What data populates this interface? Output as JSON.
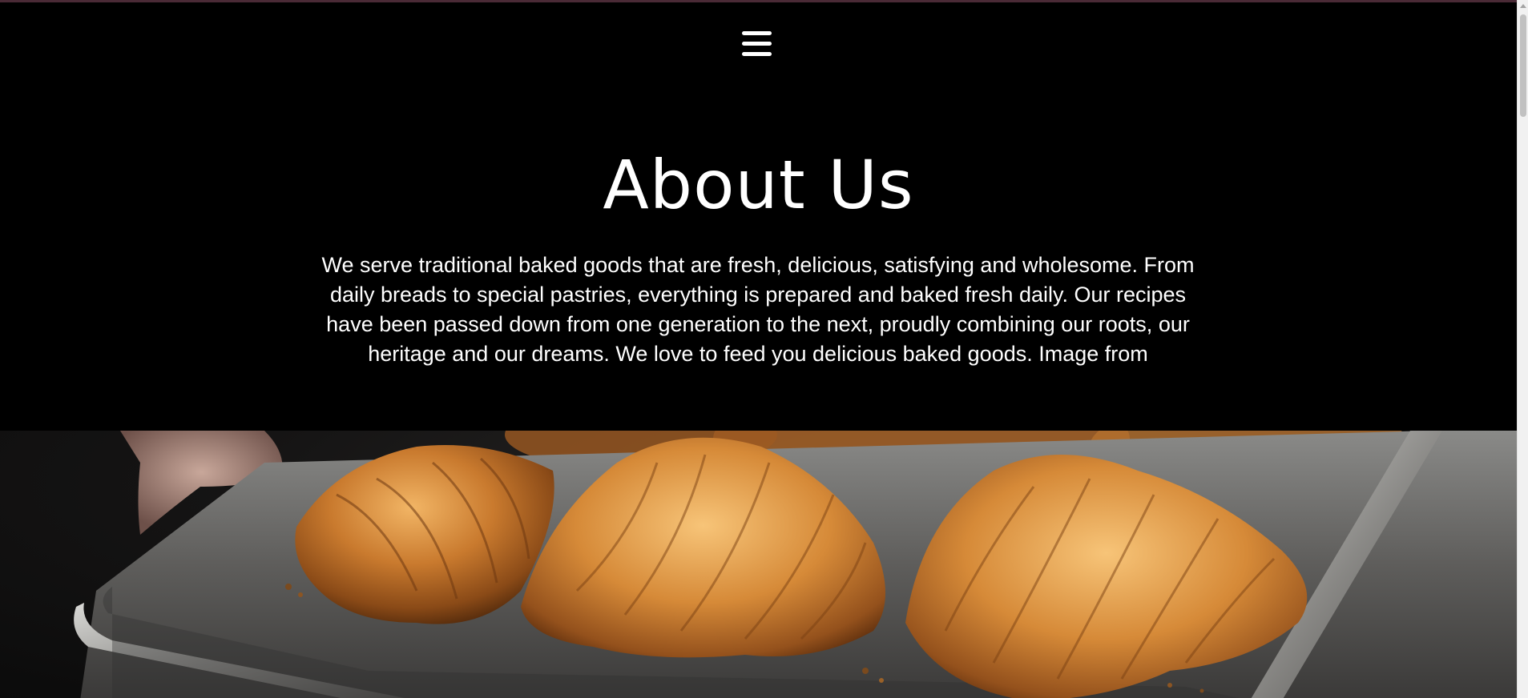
{
  "nav": {
    "menu_icon": "hamburger-menu-icon"
  },
  "about": {
    "title": "About Us",
    "body": "We serve traditional baked goods that are fresh, delicious, satisfying and wholesome. From daily breads to special pastries, everything is prepared and baked fresh daily. Our recipes have been passed down from one generation to the next, proudly combining our roots, our heritage and our dreams. We love to feed you delicious baked goods. Image from"
  },
  "hero": {
    "image_subject": "croissants-on-baking-tray"
  },
  "colors": {
    "background": "#000000",
    "text": "#ffffff",
    "top_rule": "#4a2a36",
    "scrollbar_track": "#f1f1f1",
    "scrollbar_thumb": "#c1c1c1"
  }
}
